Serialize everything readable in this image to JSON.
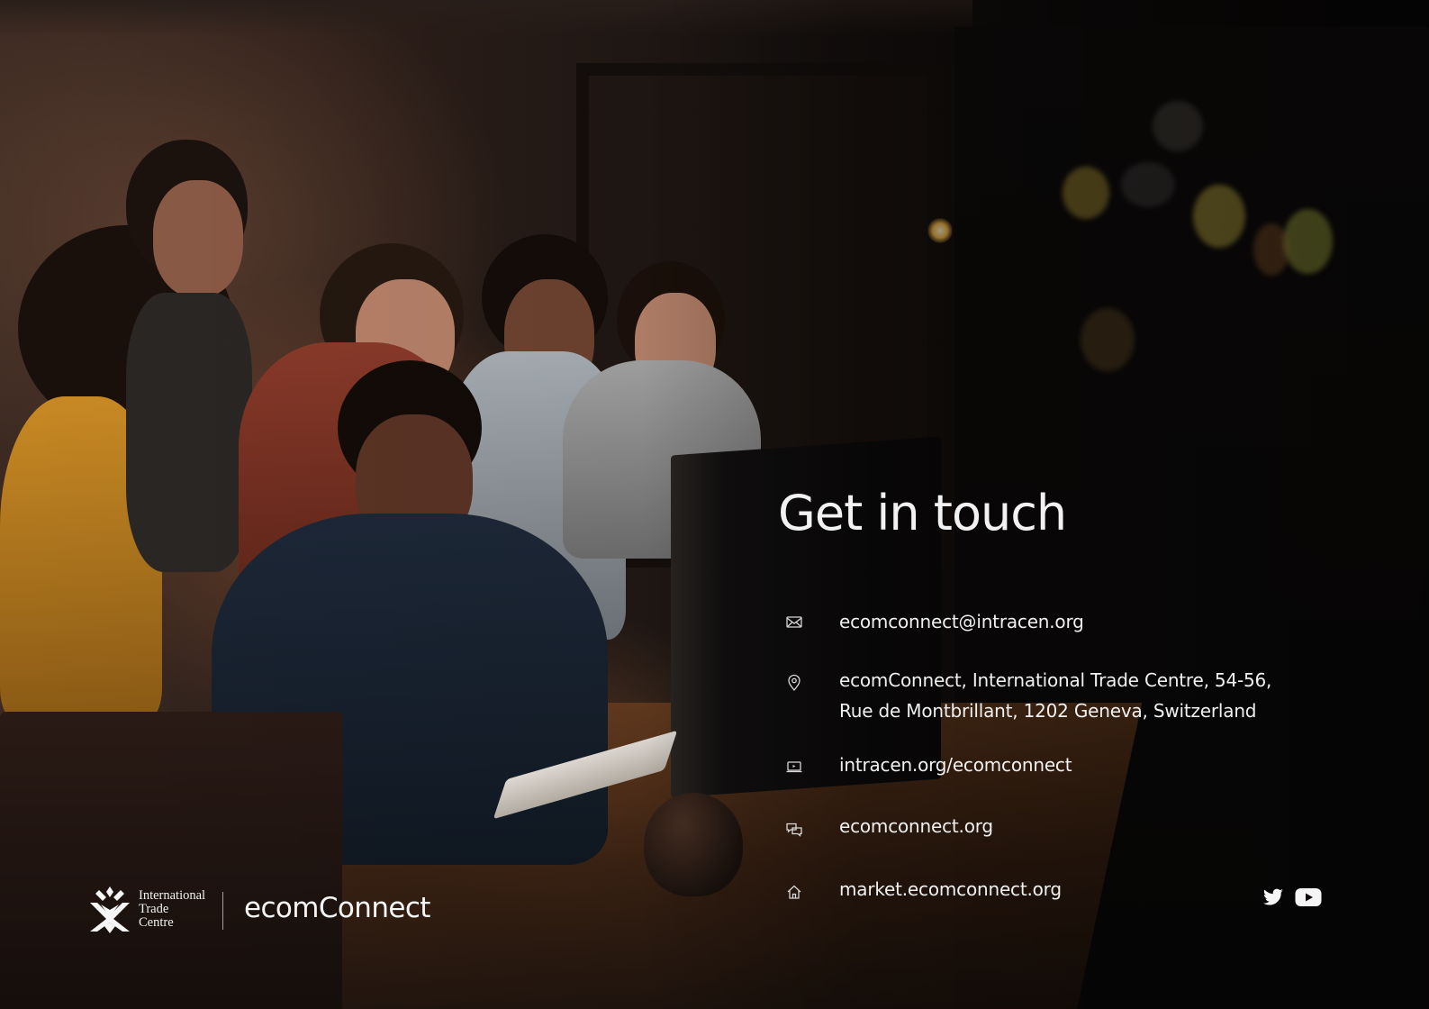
{
  "heading": "Get in touch",
  "contacts": {
    "email": "ecomconnect@intracen.org",
    "address_line1": "ecomConnect, International Trade Centre, 54-56,",
    "address_line2": "Rue de Montbrillant, 1202 Geneva, Switzerland",
    "website": "intracen.org/ecomconnect",
    "community": "ecomconnect.org",
    "market": "market.ecomconnect.org"
  },
  "icons": {
    "email": "envelope-icon",
    "address": "map-pin-icon",
    "website": "laptop-icon",
    "community": "chat-bubbles-icon",
    "market": "home-icon",
    "twitter": "twitter-icon",
    "youtube": "youtube-icon"
  },
  "logo": {
    "itc_line1": "International",
    "itc_line2": "Trade",
    "itc_line3": "Centre",
    "brand": "ecomConnect"
  },
  "colors": {
    "text": "#f0f0f0",
    "background": "#0b0807",
    "warm_light": "#f5b648"
  }
}
